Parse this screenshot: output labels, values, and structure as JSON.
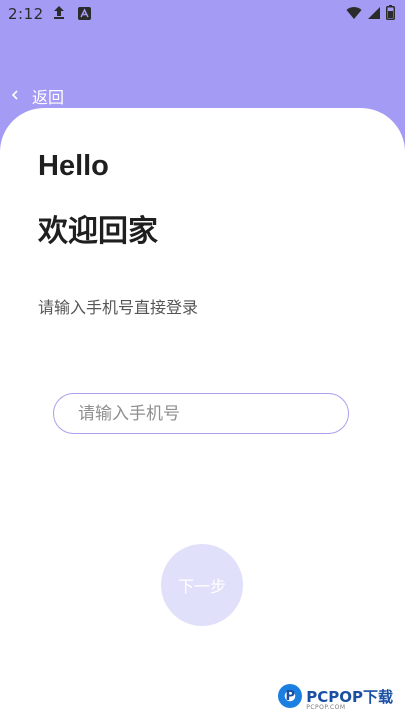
{
  "status_bar": {
    "time": "2:12",
    "upload_icon": "upload-arrow-icon",
    "a_icon": "a-badge-icon",
    "wifi_icon": "wifi-icon",
    "signal_icon": "signal-icon",
    "battery_icon": "battery-icon"
  },
  "header": {
    "back_label": "返回"
  },
  "main": {
    "hello": "Hello",
    "welcome": "欢迎回家",
    "subtitle": "请输入手机号直接登录"
  },
  "phone_input": {
    "value": "",
    "placeholder": "请输入手机号"
  },
  "next_button": {
    "label": "下一步"
  },
  "watermark": {
    "text": "PCPOP下载",
    "subtext": "PCPOP.COM"
  },
  "colors": {
    "accent": "#a49bf4",
    "button_bg": "#e1e0fb",
    "input_border": "#a9a1ee"
  }
}
